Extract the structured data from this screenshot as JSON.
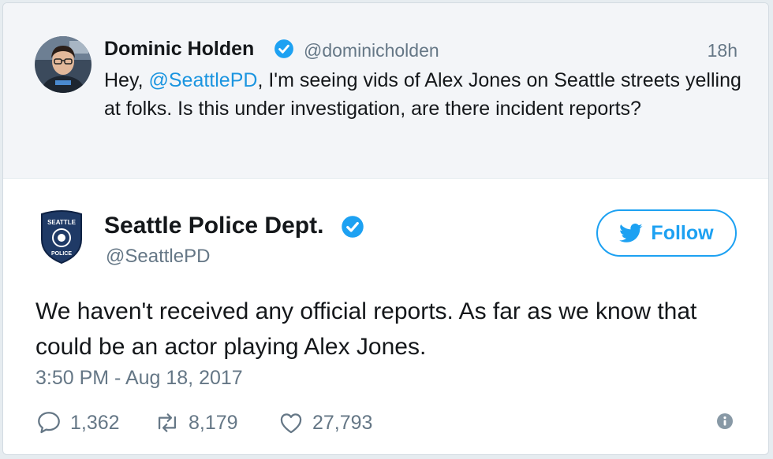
{
  "parent_tweet": {
    "author_name": "Dominic Holden",
    "author_handle": "@dominicholden",
    "time_ago": "18h",
    "text_prefix": "Hey, ",
    "mention": "@SeattlePD",
    "text_rest": ", I'm seeing vids of Alex Jones on Seattle streets yelling at folks. Is this under investigation, are there incident reports?"
  },
  "main_tweet": {
    "avatar_label_top": "SEATTLE",
    "avatar_label_bottom": "POLICE",
    "author_name": "Seattle Police Dept.",
    "author_handle": "@SeattlePD",
    "follow_label": "Follow",
    "text": "We haven't received any official reports. As far as we know that could be an actor playing Alex Jones.",
    "timestamp": "3:50 PM - Aug 18, 2017"
  },
  "actions": {
    "replies": "1,362",
    "retweets": "8,179",
    "likes": "27,793"
  },
  "colors": {
    "accent": "#1da1f2",
    "verified": "#1da1f2",
    "link": "#1b95e0",
    "muted": "#657786",
    "parent_bg": "#f3f5f8"
  },
  "icons": [
    "verified-icon",
    "twitter-bird-icon",
    "reply-icon",
    "retweet-icon",
    "like-icon",
    "info-icon"
  ]
}
